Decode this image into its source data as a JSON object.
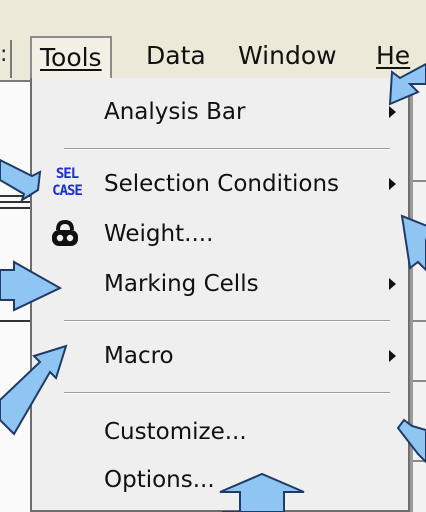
{
  "menubar": {
    "left_fragment": ":",
    "items": [
      {
        "label": "Tools"
      },
      {
        "label": "Data"
      },
      {
        "label": "Window"
      },
      {
        "label": "He"
      }
    ]
  },
  "dropdown": {
    "items": [
      {
        "label": "Analysis Bar",
        "has_submenu": true
      },
      {
        "label": "Selection Conditions",
        "has_submenu": true,
        "icon": "selcase-icon",
        "icon_text": [
          "SEL",
          "CASE"
        ]
      },
      {
        "label": "Weight....",
        "has_submenu": false,
        "icon": "weight-icon"
      },
      {
        "label": "Marking Cells",
        "has_submenu": true
      },
      {
        "label": "Macro",
        "has_submenu": true
      },
      {
        "label": "Customize...",
        "has_submenu": false
      },
      {
        "label": "Options...",
        "has_submenu": false
      }
    ]
  },
  "colors": {
    "menu_background": "#efefef",
    "pointer_arrow": "#8ec5f2",
    "pointer_outline": "#1f3b66",
    "selcase_icon": "#1b2fd0"
  }
}
